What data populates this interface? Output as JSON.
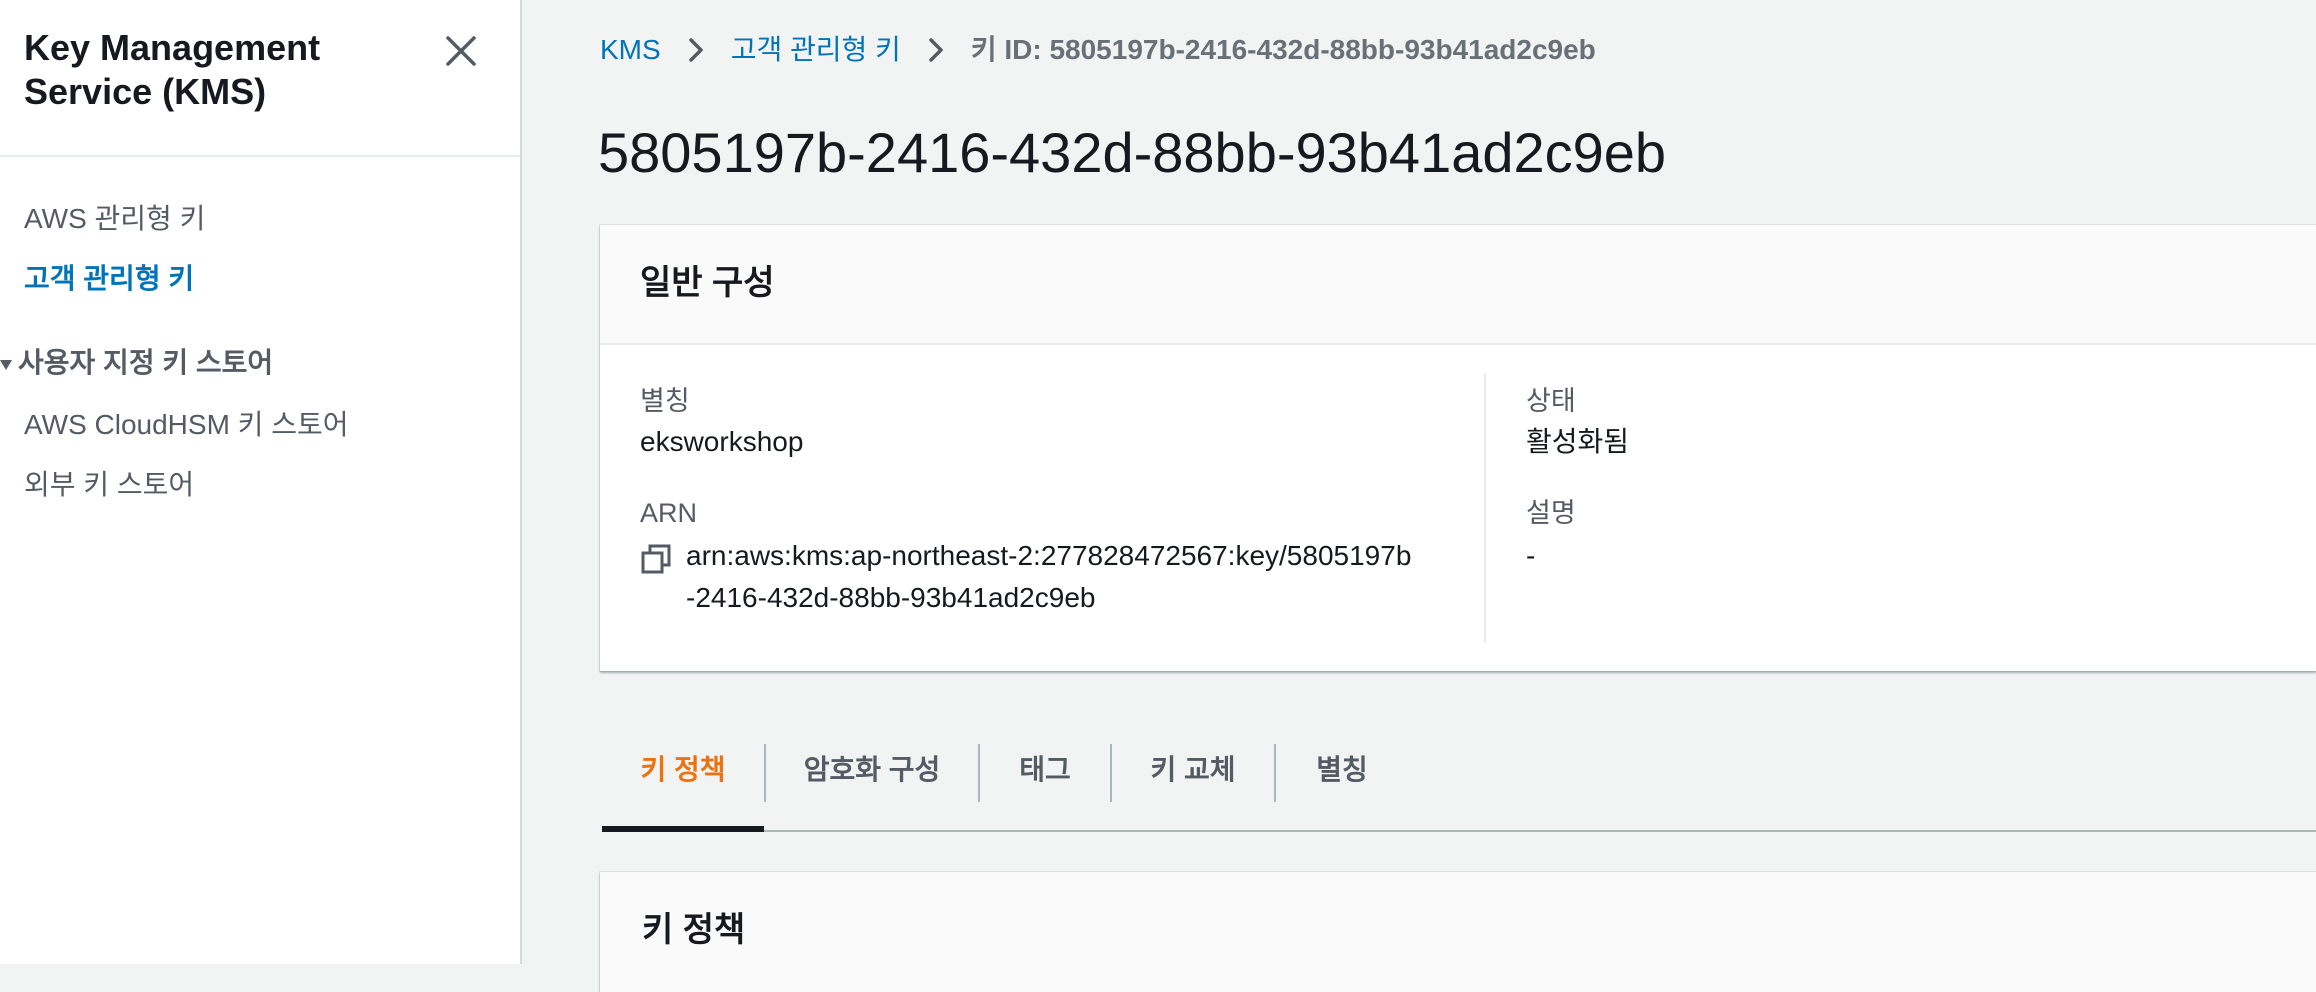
{
  "sidebar": {
    "title": "Key Management Service (KMS)",
    "items": [
      {
        "label": "AWS 관리형 키"
      },
      {
        "label": "고객 관리형 키"
      }
    ],
    "section": {
      "label": "사용자 지정 키 스토어",
      "items": [
        {
          "label": "AWS CloudHSM 키 스토어"
        },
        {
          "label": "외부 키 스토어"
        }
      ]
    }
  },
  "breadcrumb": {
    "root": "KMS",
    "parent": "고객 관리형 키",
    "current": "키 ID: 5805197b-2416-432d-88bb-93b41ad2c9eb"
  },
  "page": {
    "title": "5805197b-2416-432d-88bb-93b41ad2c9eb"
  },
  "general": {
    "title": "일반 구성",
    "alias_label": "별칭",
    "alias_value": "eksworkshop",
    "arn_label": "ARN",
    "arn_line1": "arn:aws:kms:ap-northeast-2:277828472567:key/5805197b",
    "arn_line2": "-2416-432d-88bb-93b41ad2c9eb",
    "status_label": "상태",
    "status_value": "활성화됨",
    "description_label": "설명",
    "description_value": "-"
  },
  "tabs": [
    {
      "label": "키 정책"
    },
    {
      "label": "암호화 구성"
    },
    {
      "label": "태그"
    },
    {
      "label": "키 교체"
    },
    {
      "label": "별칭"
    }
  ],
  "policy": {
    "title": "키 정책"
  },
  "colors": {
    "link": "#0073bb",
    "active_tab": "#ec7211",
    "text": "#16191f",
    "muted": "#545b64"
  }
}
